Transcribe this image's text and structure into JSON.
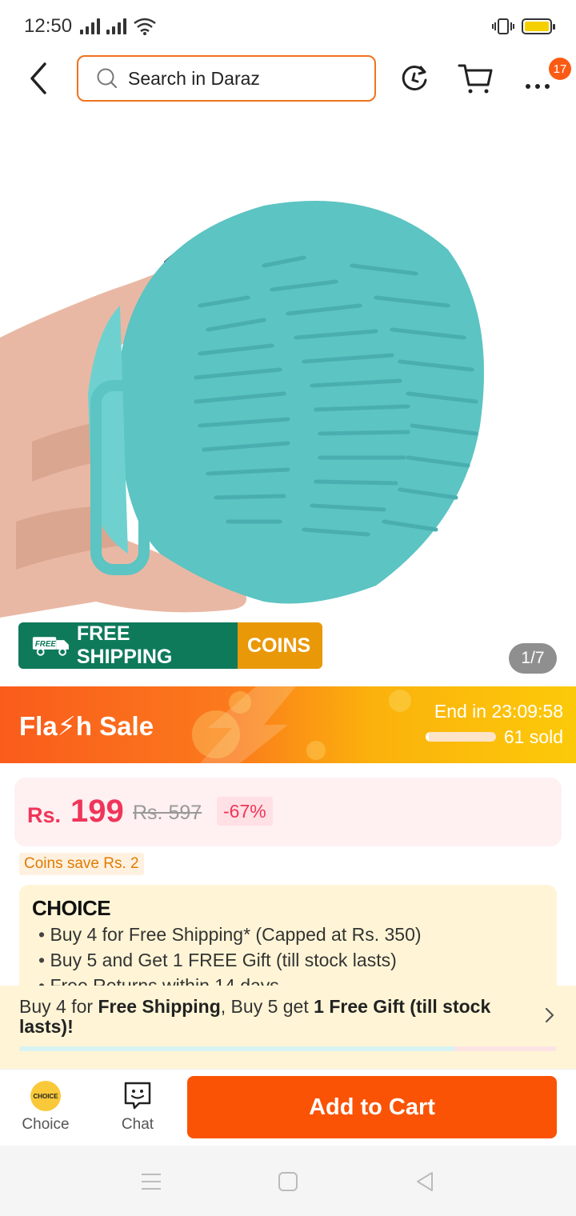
{
  "status_bar": {
    "time": "12:50"
  },
  "header": {
    "search_placeholder": "Search in Daraz",
    "cart_badge": "17"
  },
  "product": {
    "shipping_label": "FREE SHIPPING",
    "shipping_icon_text": "FREE",
    "coins_label": "COINS",
    "image_counter": "1/7"
  },
  "flash_sale": {
    "title": "Fla⚡h Sale",
    "end_label": "End in",
    "countdown": "23:09:58",
    "sold": "61 sold",
    "sold_fraction": 0.05
  },
  "price": {
    "currency": "Rs.",
    "value": "199",
    "original": "Rs. 597",
    "discount": "-67%"
  },
  "coins_save": "Coins save Rs. 2",
  "choice": {
    "logo": "CHOICE",
    "benefits": [
      "Buy 4 for  Free Shipping* (Capped at Rs. 350)",
      "Buy 5 and Get 1 FREE Gift (till stock lasts)",
      "Free Returns within 14 days"
    ]
  },
  "promo": {
    "t1": "Buy 4 for ",
    "b1": "Free Shipping",
    "t2": ", Buy 5 get ",
    "b2": "1 Free Gift (till stock lasts)!",
    "progress_fraction": 0.81
  },
  "action_bar": {
    "choice_label": "Choice",
    "choice_badge": "CHOICE",
    "chat_label": "Chat",
    "add_to_cart": "Add to Cart"
  },
  "colors": {
    "brand": "#fa5306",
    "price": "#f0355a",
    "shipping": "#0e7a5a",
    "coins": "#e99808"
  }
}
